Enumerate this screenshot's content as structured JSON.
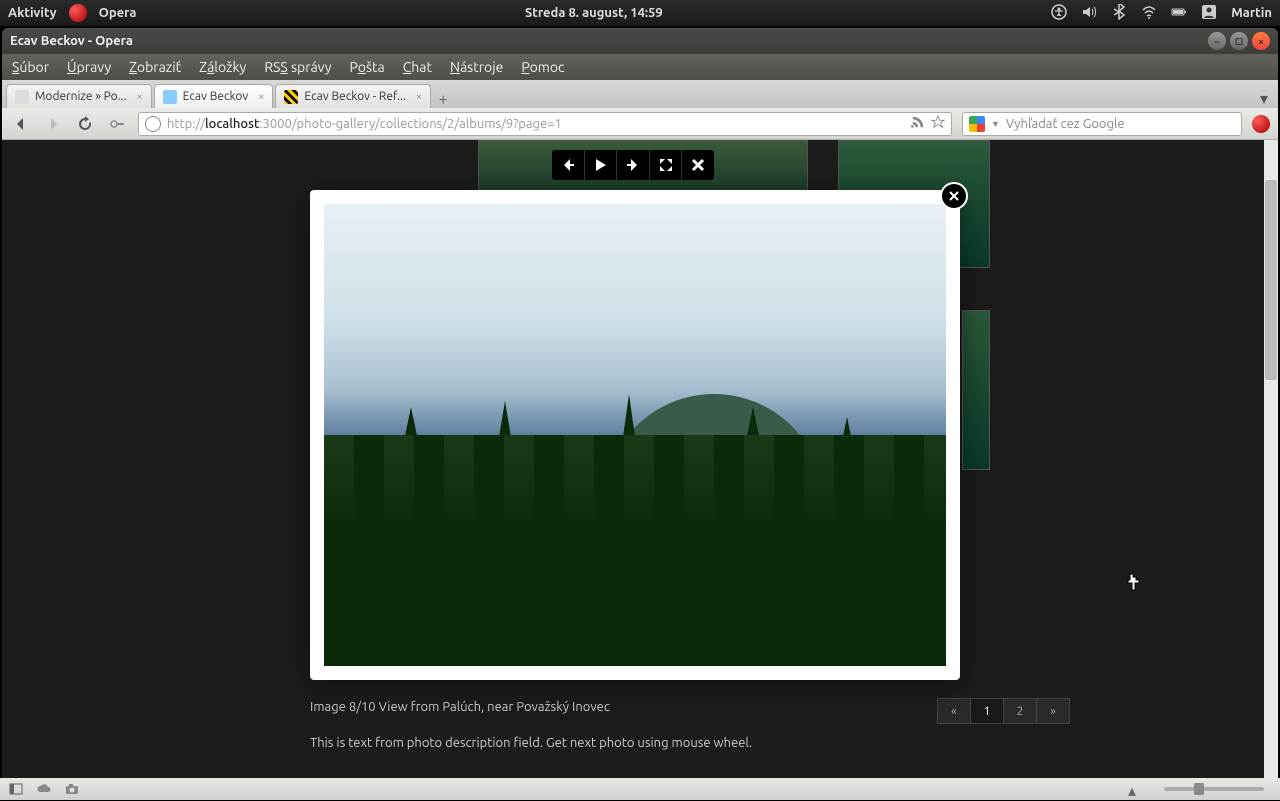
{
  "sysbar": {
    "activity": "Aktivity",
    "app": "Opera",
    "datetime": "Streda  8. august, 14:59",
    "user": "Martin"
  },
  "window": {
    "title": "Ecav Beckov - Opera"
  },
  "menu": {
    "file": "Súbor",
    "edit": "Úpravy",
    "view": "Zobraziť",
    "bookmarks": "Záložky",
    "rss": "RSS správy",
    "mail": "Pošta",
    "chat": "Chat",
    "tools": "Nástroje",
    "help": "Pomoc"
  },
  "tabs": [
    {
      "label": "Modernize » Po..."
    },
    {
      "label": "Ecav Beckov"
    },
    {
      "label": "Ecav Beckov - Ref..."
    }
  ],
  "url": {
    "proto": "http://",
    "host": "localhost",
    "port": ":3000",
    "path": "/photo-gallery/collections/2/albums/9?page=1"
  },
  "search": {
    "placeholder": "Vyhľadať cez Google"
  },
  "lightbox": {
    "counter_title": "Image 8/10 View from Palúch, near Považský Inovec",
    "description": "This is text from photo description field. Get next photo using mouse wheel."
  },
  "pagination": {
    "prev": "«",
    "p1": "1",
    "p2": "2",
    "next": "»"
  }
}
